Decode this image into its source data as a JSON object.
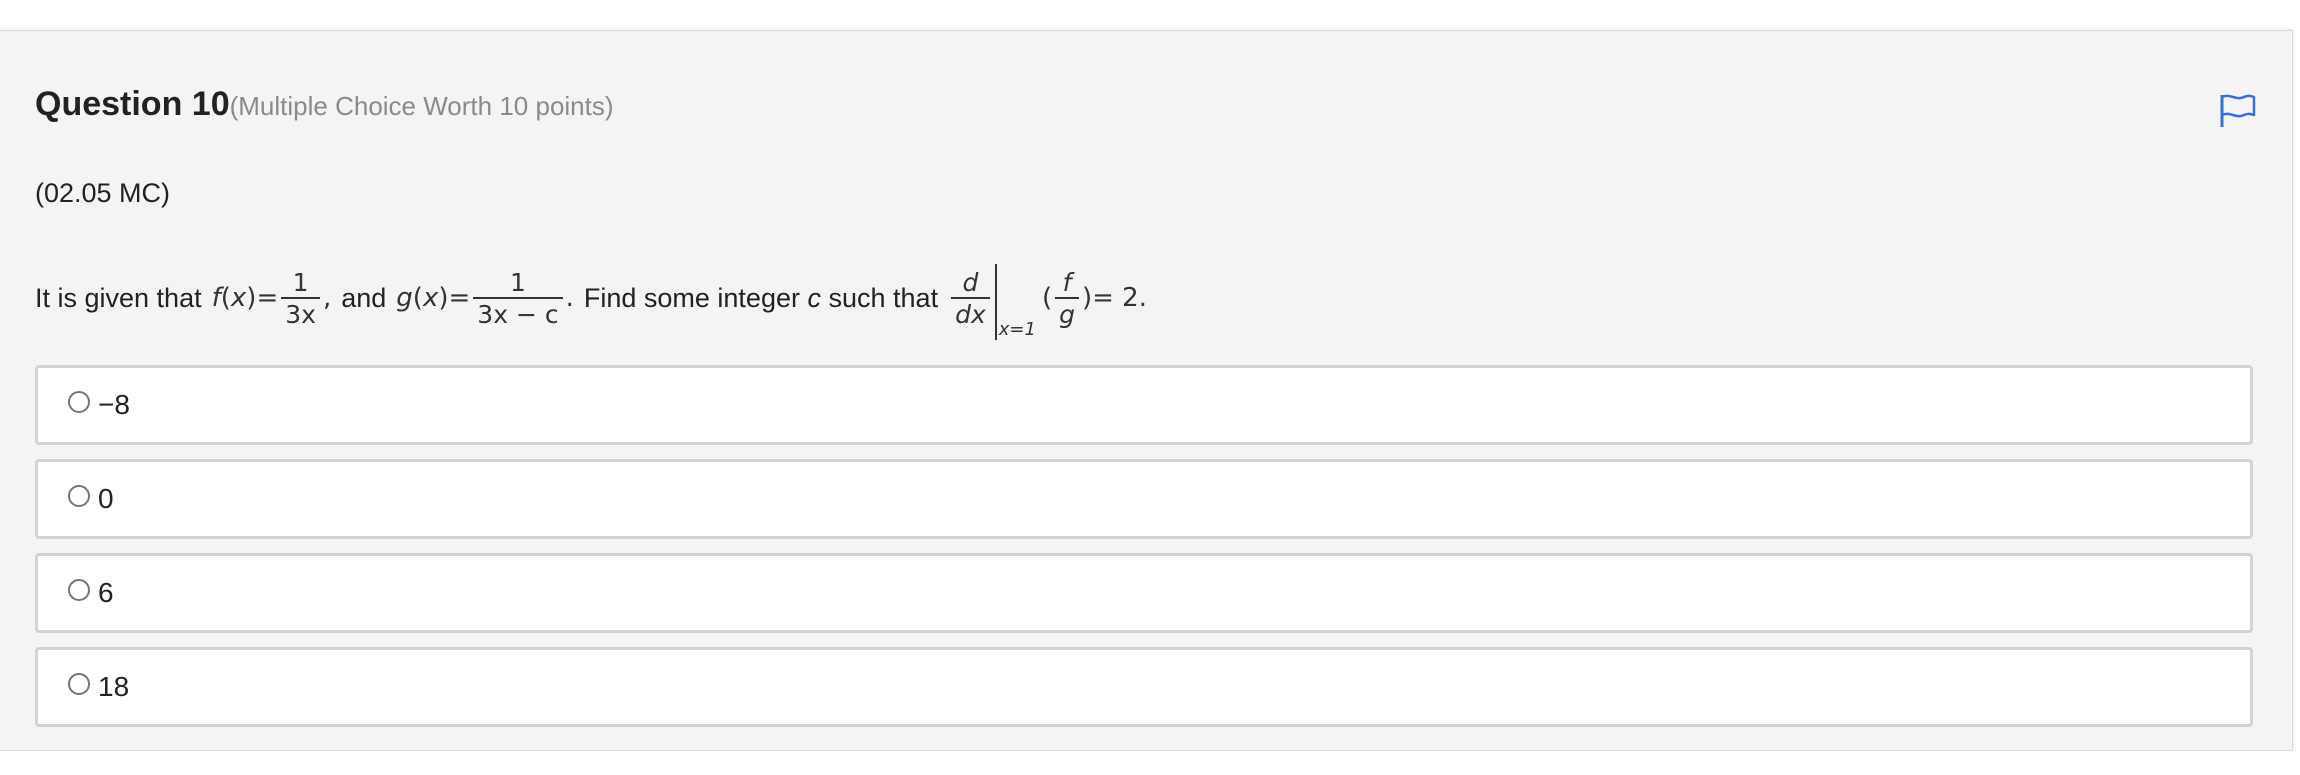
{
  "question": {
    "title": "Question 10",
    "subtitle": "(Multiple Choice Worth 10 points)",
    "code": "(02.05 MC)",
    "flag_icon": "flag-icon",
    "accent_color": "#3a6fd8"
  },
  "prompt": {
    "intro": "It is given that",
    "f_name": "f",
    "g_name": "g",
    "x_var": "x",
    "f_open": "(",
    "f_close": ")",
    "equals": "=",
    "f_num": "1",
    "f_den": "3x",
    "comma": ",",
    "and": "and",
    "g_num": "1",
    "g_den": "3x − c",
    "period": ".",
    "find": "Find some integer",
    "c_var": "c",
    "such_that": "such that",
    "d_num": "d",
    "d_den": "dx",
    "eval_at": "x=1",
    "fg_num": "f",
    "fg_den": "g",
    "paren_open": "(",
    "paren_close": ")",
    "result": "= 2."
  },
  "options": [
    {
      "label": "−8"
    },
    {
      "label": "0"
    },
    {
      "label": "6"
    },
    {
      "label": "18"
    }
  ]
}
